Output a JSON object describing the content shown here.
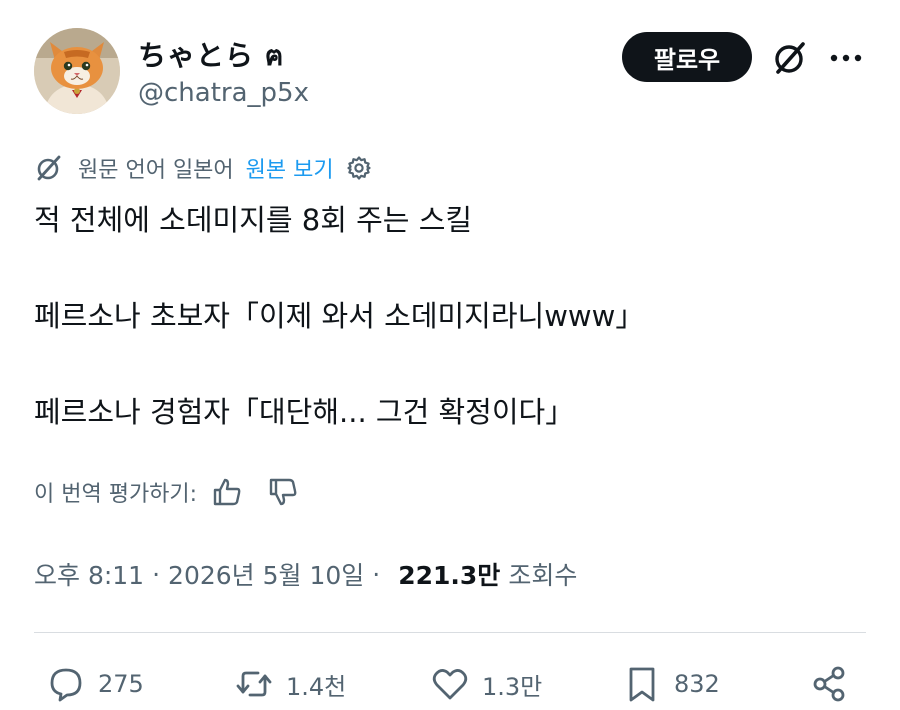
{
  "user": {
    "display_name": "ちゃとら ฅ",
    "handle": "@chatra_p5x",
    "follow_label": "팔로우"
  },
  "translation": {
    "notice": "원문 언어 일본어",
    "show_original": "원본 보기"
  },
  "tweet": {
    "lines": [
      "적 전체에 소데미지를 8회 주는 스킬",
      "페르소나 초보자「이제 와서 소데미지라니www」",
      "페르소나 경험자「대단해... 그건 확정이다」"
    ]
  },
  "rate": {
    "label": "이 번역 평가하기:"
  },
  "meta": {
    "time": "오후 8:11",
    "separator": "·",
    "date": "2026년 5월 10일",
    "views_count": "221.3만",
    "views_label": "조회수"
  },
  "actions": {
    "replies": "275",
    "reposts": "1.4천",
    "likes": "1.3만",
    "bookmarks": "832"
  },
  "icons": {
    "avatar": "orange-cat-avatar",
    "grok": "grok-icon",
    "more": "more-icon",
    "translate": "translate-icon",
    "gear": "gear-icon",
    "thumbs_up": "thumbs-up-icon",
    "thumbs_down": "thumbs-down-icon",
    "reply": "reply-icon",
    "repost": "repost-icon",
    "like": "heart-icon",
    "bookmark": "bookmark-icon",
    "share": "share-icon"
  },
  "colors": {
    "text_primary": "#0f1419",
    "text_secondary": "#536471",
    "link": "#1d9bf0",
    "follow_bg": "#0f1419",
    "divider": "#d9dde1"
  }
}
